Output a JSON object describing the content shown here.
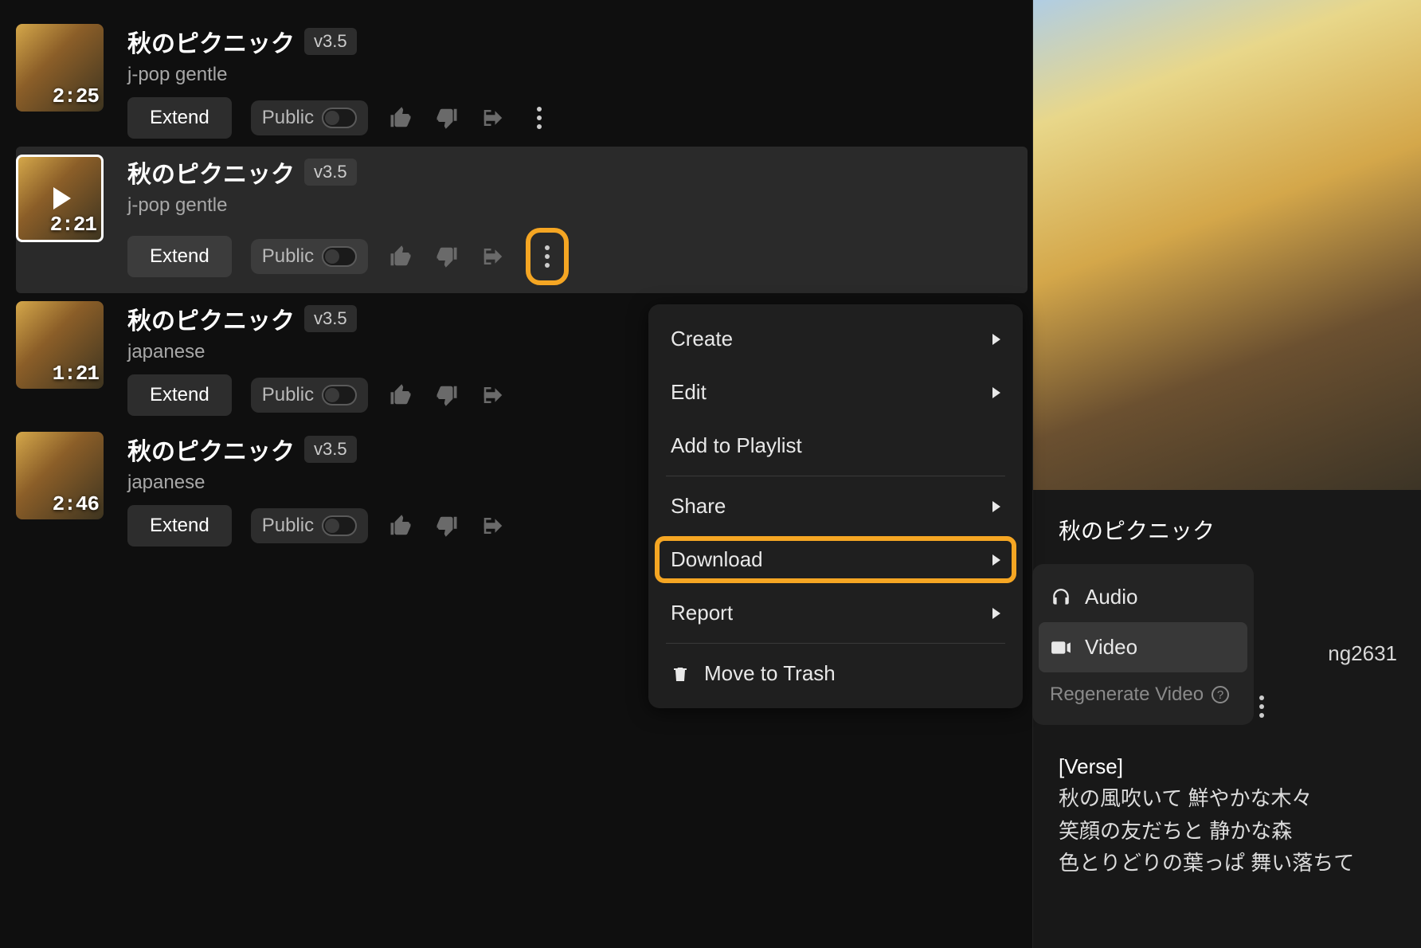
{
  "songs": [
    {
      "title": "秋のピクニック",
      "version": "v3.5",
      "tags": "j-pop gentle",
      "duration": "2:25",
      "extend": "Extend",
      "public": "Public",
      "selected": false
    },
    {
      "title": "秋のピクニック",
      "version": "v3.5",
      "tags": "j-pop gentle",
      "duration": "2:21",
      "extend": "Extend",
      "public": "Public",
      "selected": true
    },
    {
      "title": "秋のピクニック",
      "version": "v3.5",
      "tags": "japanese",
      "duration": "1:21",
      "extend": "Extend",
      "public": "Public",
      "selected": false
    },
    {
      "title": "秋のピクニック",
      "version": "v3.5",
      "tags": "japanese",
      "duration": "2:46",
      "extend": "Extend",
      "public": "Public",
      "selected": false
    }
  ],
  "menu": {
    "create": "Create",
    "edit": "Edit",
    "add_playlist": "Add to Playlist",
    "share": "Share",
    "download": "Download",
    "report": "Report",
    "trash": "Move to Trash"
  },
  "submenu": {
    "audio": "Audio",
    "video": "Video",
    "regen": "Regenerate Video"
  },
  "detail": {
    "title": "秋のピクニック",
    "user_suffix": "ng2631",
    "lyrics_header": "[Verse]",
    "line1": "秋の風吹いて 鮮やかな木々",
    "line2": "笑顔の友だちと 静かな森",
    "line3": "色とりどりの葉っぱ 舞い落ちて"
  }
}
